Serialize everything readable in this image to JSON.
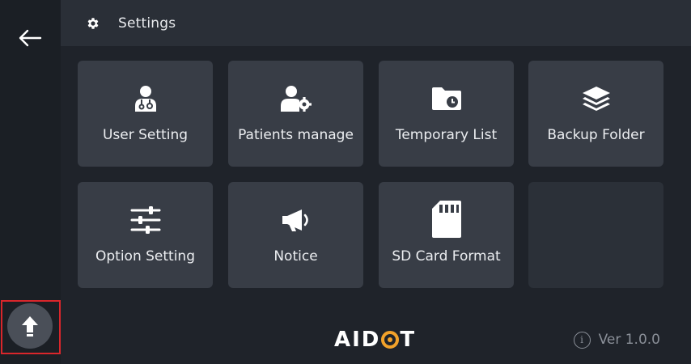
{
  "header": {
    "title": "Settings",
    "icon": "gear-icon"
  },
  "sidebar": {
    "back_icon": "arrow-left-icon",
    "upload_icon": "arrow-up-icon"
  },
  "tiles": [
    {
      "label": "User Setting",
      "icon": "doctor-user-icon"
    },
    {
      "label": "Patients manage",
      "icon": "patient-gear-icon"
    },
    {
      "label": "Temporary List",
      "icon": "folder-clock-icon"
    },
    {
      "label": "Backup Folder",
      "icon": "layers-icon"
    },
    {
      "label": "Option Setting",
      "icon": "sliders-icon"
    },
    {
      "label": "Notice",
      "icon": "megaphone-icon"
    },
    {
      "label": "SD Card Format",
      "icon": "sd-card-icon"
    }
  ],
  "footer": {
    "logo_left": "AID",
    "logo_right": "T",
    "version": "Ver 1.0.0"
  },
  "colors": {
    "accent": "#f2a22a",
    "highlight": "#d9262b",
    "tile": "#383d46"
  }
}
